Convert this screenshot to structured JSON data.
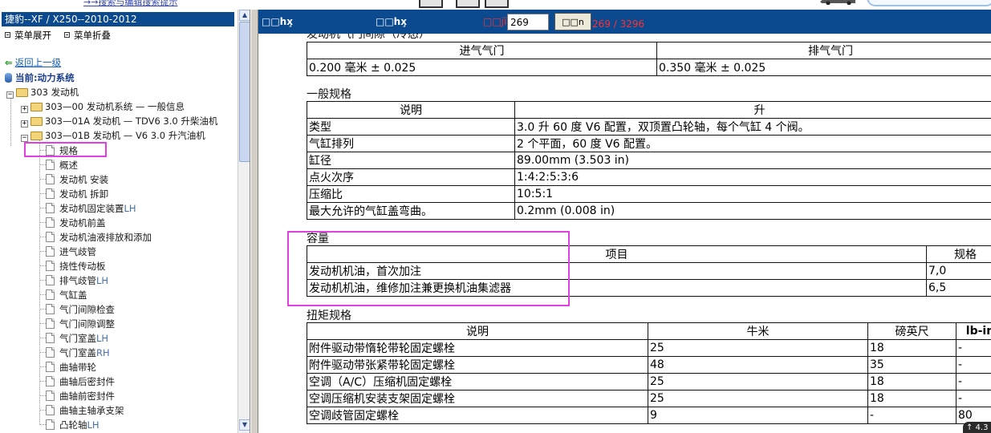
{
  "top": {
    "link": "→→搜索与编辑搜索提示"
  },
  "left": {
    "title": "捷豹--XF / X250--2010-2012",
    "expand_all": "菜单展开",
    "collapse_all": "菜单折叠",
    "back": "返回上一级",
    "current": "当前:动力系统",
    "tree": {
      "root": "303 发动机",
      "sub0": "303—00 发动机系统 — 一般信息",
      "sub1": "303—01A 发动机 — TDV6 3.0 升柴油机",
      "sub2": "303—01B 发动机 — V6 3.0 升汽油机",
      "leaves": [
        "规格",
        "概述",
        "发动机 安装",
        "发动机 拆卸",
        "发动机固定装置LH",
        "发动机前盖",
        "发动机油液排放和添加",
        "进气歧管",
        "挠性传动板",
        "排气歧管LH",
        "气缸盖",
        "气门间隙检查",
        "气门间隙调整",
        "气门室盖LH",
        "气门室盖RH",
        "曲轴带轮",
        "曲轴后密封件",
        "曲轴前密封件",
        "曲轴主轴承支架",
        "凸轮轴LH"
      ]
    }
  },
  "right": {
    "header": {
      "label1": "□□hx̧",
      "label2": "□□hx̧",
      "page_label": "□□jï",
      "page_value": "269",
      "go": "□□n",
      "page_count": "269 / 3296"
    },
    "valve": {
      "title": "发动机气门间隙（冷态）",
      "col_intake": "进气气门",
      "col_exhaust": "排气气门",
      "intake": "0.200 毫米 ± 0.025",
      "exhaust": "0.350 毫米 ± 0.025"
    },
    "general": {
      "title": "一般规格",
      "col_desc": "说明",
      "col_value": "升",
      "rows": [
        {
          "k": "类型",
          "v": "3.0 升 60 度 V6 配置，双顶置凸轮轴，每个气缸 4 个阀。"
        },
        {
          "k": "气缸排列",
          "v": "2 个平面，60 度 V6 配置。"
        },
        {
          "k": "缸径",
          "v": "89.00mm (3.503 in)"
        },
        {
          "k": "点火次序",
          "v": "1:4:2:5:3:6"
        },
        {
          "k": "压缩比",
          "v": "10:5:1"
        },
        {
          "k": "最大允许的气缸盖弯曲。",
          "v": "0.2mm (0.008 in)"
        }
      ]
    },
    "capacity": {
      "title": "容量",
      "col_item": "项目",
      "col_spec": "规格",
      "rows": [
        {
          "k": "发动机机油，首次加注",
          "v": "7,0"
        },
        {
          "k": "发动机机油，维修加注兼更换机油集滤器",
          "v": "6,5"
        }
      ]
    },
    "torque": {
      "title": "扭矩规格",
      "col_desc": "说明",
      "col_nm": "牛米",
      "col_lbft": "磅英尺",
      "col_lbin": "lb-in",
      "rows": [
        {
          "k": "附件驱动带惰轮带轮固定螺栓",
          "nm": "25",
          "lbft": "18",
          "lbin": "-"
        },
        {
          "k": "附件驱动带张紧带轮固定螺栓",
          "nm": "48",
          "lbft": "35",
          "lbin": "-"
        },
        {
          "k": "空调（A/C）压缩机固定螺栓",
          "nm": "25",
          "lbft": "18",
          "lbin": "-"
        },
        {
          "k": "空调压缩机安装支架固定螺栓",
          "nm": "25",
          "lbft": "18",
          "lbin": "-"
        },
        {
          "k": "空调歧管固定螺栓",
          "nm": "9",
          "lbft": "-",
          "lbin": "80"
        }
      ]
    }
  },
  "badge": "↑ 4.3"
}
